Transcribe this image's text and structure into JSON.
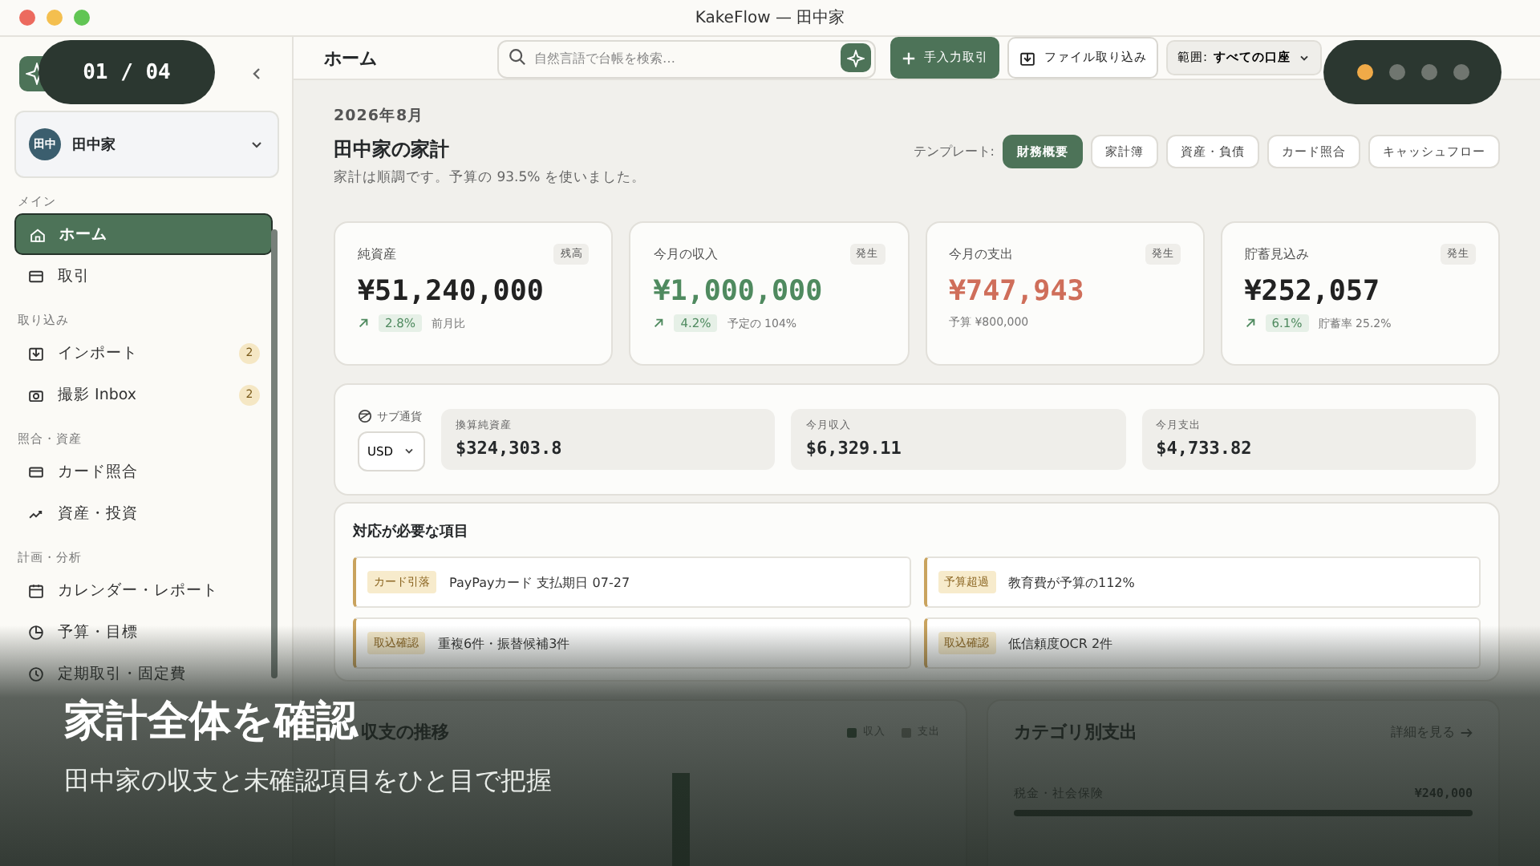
{
  "window": {
    "title": "KakeFlow — 田中家"
  },
  "slide": {
    "counter": "01 / 04",
    "title": "家計全体を確認",
    "subtitle": "田中家の収支と未確認項目をひと目で把握",
    "dots": [
      {
        "selected": true
      },
      {
        "selected": false
      },
      {
        "selected": false
      },
      {
        "selected": false
      }
    ]
  },
  "sidebar": {
    "household": {
      "avatar": "田中",
      "name": "田中家"
    },
    "sections": [
      {
        "label": "メイン",
        "items": [
          {
            "label": "ホーム",
            "selected": true
          },
          {
            "label": "取引",
            "selected": false
          }
        ]
      },
      {
        "label": "取り込み",
        "items": [
          {
            "label": "インポート",
            "selected": false,
            "badge": "2"
          },
          {
            "label": "撮影 Inbox",
            "selected": false,
            "badge": "2"
          }
        ]
      },
      {
        "label": "照合・資産",
        "items": [
          {
            "label": "カード照合",
            "selected": false
          },
          {
            "label": "資産・投資",
            "selected": false
          }
        ]
      },
      {
        "label": "計画・分析",
        "items": [
          {
            "label": "カレンダー・レポート",
            "selected": false
          },
          {
            "label": "予算・目標",
            "selected": false
          },
          {
            "label": "定期取引・固定費",
            "selected": false
          }
        ]
      }
    ]
  },
  "header": {
    "title": "ホーム",
    "search": {
      "placeholder": "自然言語で台帳を検索…"
    },
    "buttons": [
      {
        "label": "手入力取引",
        "kind": "primary"
      },
      {
        "label": "ファイル取り込み",
        "kind": "secondary"
      }
    ],
    "scope": {
      "label": "範囲:",
      "value": "すべての口座"
    }
  },
  "overview": {
    "month": "2026年8月",
    "title": "田中家の家計",
    "summary": "家計は順調です。予算の 93.5% を使いました。",
    "template_label": "テンプレート:",
    "templates": [
      {
        "label": "財務概要",
        "selected": true
      },
      {
        "label": "家計簿",
        "selected": false
      },
      {
        "label": "資産・負債",
        "selected": false
      },
      {
        "label": "カード照合",
        "selected": false
      },
      {
        "label": "キャッシュフロー",
        "selected": false
      }
    ]
  },
  "cards": [
    {
      "label": "純資産",
      "badge": "残高",
      "value": "¥51,240,000",
      "kind": "neutral",
      "change": "2.8%",
      "note": "前月比"
    },
    {
      "label": "今月の収入",
      "badge": "発生",
      "value": "¥1,000,000",
      "kind": "positive",
      "change": "4.2%",
      "note": "予定の 104%"
    },
    {
      "label": "今月の支出",
      "badge": "発生",
      "value": "¥747,943",
      "kind": "negative",
      "note": "予算 ¥800,000"
    },
    {
      "label": "貯蓄見込み",
      "badge": "発生",
      "value": "¥252,057",
      "kind": "neutral",
      "change": "6.1%",
      "note": "貯蓄率 25.2%"
    }
  ],
  "sub_currency": {
    "label": "サブ通貨",
    "currency": "USD",
    "items": [
      {
        "label": "換算純資産",
        "value": "$324,303.8"
      },
      {
        "label": "今月収入",
        "value": "$6,329.11"
      },
      {
        "label": "今月支出",
        "value": "$4,733.82"
      }
    ]
  },
  "action_items": {
    "title": "対応が必要な項目",
    "items": [
      {
        "tag": "カード引落",
        "text": "PayPayカード 支払期日 07-27"
      },
      {
        "tag": "予算超過",
        "text": "教育費が予算の112%"
      },
      {
        "tag": "取込確認",
        "text": "重複6件・振替候補3件"
      },
      {
        "tag": "取込確認",
        "text": "低信頼度OCR 2件"
      }
    ]
  },
  "trend": {
    "title": "収支の推移",
    "legend": [
      {
        "label": "収入"
      },
      {
        "label": "支出"
      }
    ]
  },
  "categories": {
    "title": "カテゴリ別支出",
    "link": "詳細を見る",
    "rows": [
      {
        "label": "税金・社会保険",
        "amount": "¥240,000",
        "level": 1.0
      }
    ]
  }
}
